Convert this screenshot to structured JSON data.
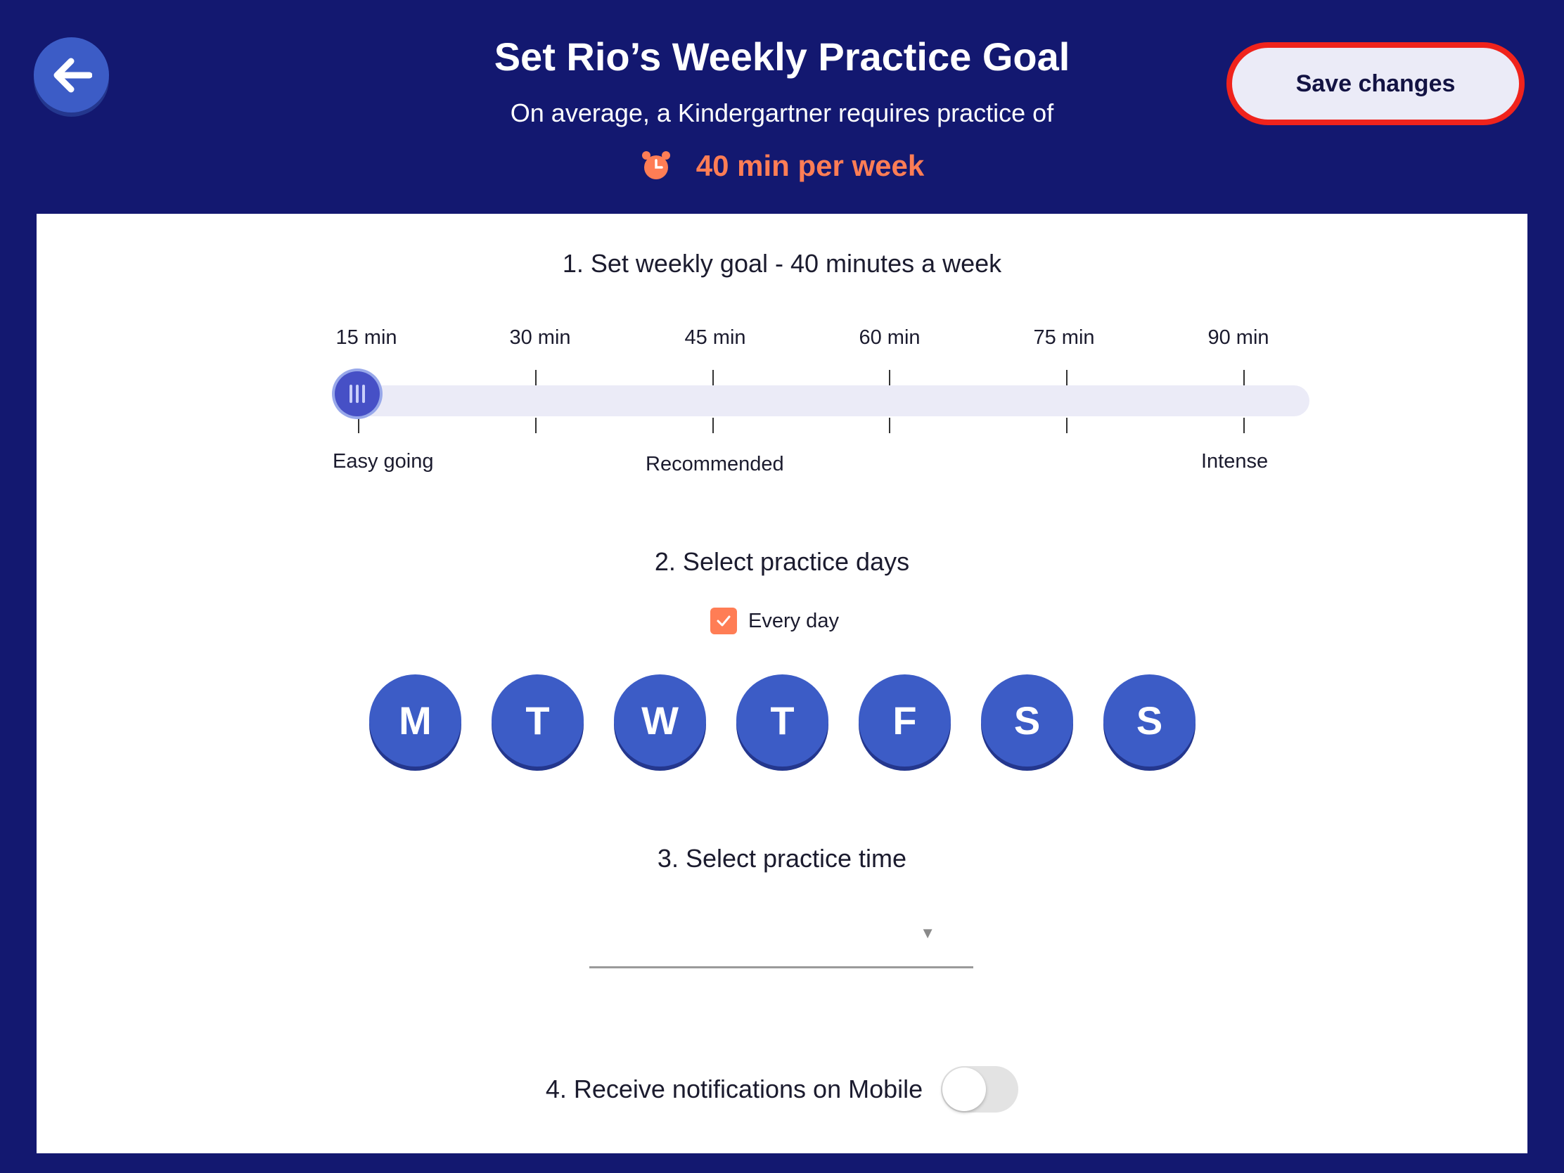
{
  "header": {
    "title": "Set Rio’s Weekly Practice Goal",
    "subtitle": "On average, a Kindergartner requires practice of",
    "recommended_goal": "40 min per week",
    "save_label": "Save changes"
  },
  "colors": {
    "background": "#131870",
    "accent": "#ff7d55",
    "primary": "#3c5cc6",
    "save_border": "#f0231c"
  },
  "icons": {
    "back": "arrow-left-icon",
    "clock": "alarm-clock-icon",
    "check": "checkmark-icon"
  },
  "goal_section": {
    "title": "1. Set weekly goal - 40 minutes a week",
    "ticks": [
      "15 min",
      "30 min",
      "45 min",
      "60 min",
      "75 min",
      "90 min"
    ],
    "slider_value": "15 min",
    "labels": {
      "easy": "Easy going",
      "recommended": "Recommended",
      "intense": "Intense"
    }
  },
  "days_section": {
    "title": "2. Select practice days",
    "every_day_label": "Every day",
    "every_day_checked": true,
    "days": [
      "M",
      "T",
      "W",
      "T",
      "F",
      "S",
      "S"
    ]
  },
  "time_section": {
    "title": "3. Select practice time",
    "value": ""
  },
  "notifications_section": {
    "title": "4. Receive notifications on Mobile",
    "enabled": false
  }
}
